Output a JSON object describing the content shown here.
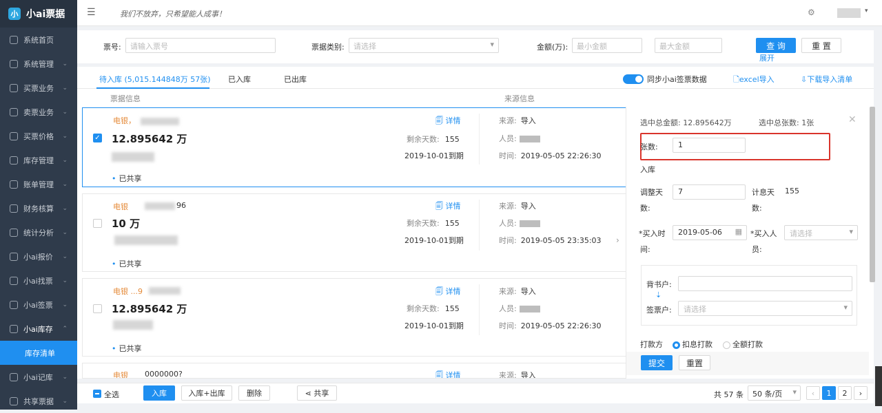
{
  "app": {
    "title": "小ai票据",
    "logo": "小",
    "slogan": "我们不放弃，只希望能人成事！"
  },
  "header": {
    "menu_icon": "☰",
    "settings_icon": "⚙",
    "caret": "▾"
  },
  "sidebar": {
    "items": [
      {
        "label": "系统首页"
      },
      {
        "label": "系统管理",
        "chevron": "⌄"
      },
      {
        "label": "买票业务",
        "chevron": "⌄"
      },
      {
        "label": "卖票业务",
        "chevron": "⌄"
      },
      {
        "label": "买票价格",
        "chevron": "⌄"
      },
      {
        "label": "库存管理",
        "chevron": "⌄"
      },
      {
        "label": "账单管理",
        "chevron": "⌄"
      },
      {
        "label": "财务核算",
        "chevron": "⌄"
      },
      {
        "label": "统计分析",
        "chevron": "⌄"
      },
      {
        "label": "小ai报价",
        "chevron": "⌄"
      },
      {
        "label": "小ai找票",
        "chevron": "⌄"
      },
      {
        "label": "小ai签票",
        "chevron": "⌄"
      },
      {
        "label": "小ai库存",
        "chevron": "⌃"
      },
      {
        "label": "小ai记库",
        "chevron": "⌄"
      },
      {
        "label": "共享票据",
        "chevron": "⌄"
      }
    ],
    "active_sub": "库存清单"
  },
  "filter": {
    "ticket_no_label": "票号:",
    "ticket_no_placeholder": "请输入票号",
    "type_label": "票据类别:",
    "type_placeholder": "请选择",
    "amount_label": "金额(万):",
    "min_placeholder": "最小金额",
    "max_placeholder": "最大金额",
    "query": "查 询",
    "reset": "重 置",
    "expand": "展开"
  },
  "tabs": {
    "pending": "待入库 (5,015.144848万 57张)",
    "in": "已入库",
    "out": "已出库",
    "sync": "同步小ai签票数据",
    "excel": "excel导入",
    "download": "下载导入清单"
  },
  "columns": {
    "ticket": "票据信息",
    "source": "来源信息"
  },
  "cards": [
    {
      "type": "电银，",
      "amount": "12.895642 万",
      "shared": "已共享",
      "detail": "详情",
      "days_label": "剩余天数:",
      "days": "155",
      "due": "2019-10-01到期",
      "src_label": "来源:",
      "src": "导入",
      "person_label": "人员:",
      "time_label": "时间:",
      "time": "2019-05-05 22:26:30",
      "checked": "✓"
    },
    {
      "type": "电银",
      "suffix": "96",
      "amount": "10 万",
      "shared": "已共享",
      "detail": "详情",
      "days_label": "剩余天数:",
      "days": "155",
      "due": "2019-10-01到期",
      "src_label": "来源:",
      "src": "导入",
      "person_label": "人员:",
      "time_label": "时间:",
      "time": "2019-05-05 23:35:03"
    },
    {
      "type": "电银 ...9",
      "amount": "12.895642 万",
      "shared": "已共享",
      "detail": "详情",
      "days_label": "剩余天数:",
      "days": "155",
      "due": "2019-10-01到期",
      "src_label": "来源:",
      "src": "导入",
      "person_label": "人员:",
      "time_label": "时间:",
      "time": "2019-05-05 22:26:30"
    },
    {
      "type": "电银",
      "suffix": "0000000?",
      "detail": "详情",
      "src_label": "来源:",
      "src": "导入"
    }
  ],
  "panel": {
    "total_amount": "选中总金额: 12.895642万",
    "total_count": "选中总张数: 1张",
    "count_label": "张数:",
    "count_value": "1",
    "in_label": "入库",
    "adjust_label_1": "调整天",
    "adjust_label_2": "数:",
    "adjust_value": "7",
    "interest_label_1": "计息天",
    "interest_label_2": "数:",
    "interest_value": "155",
    "buy_time_label_1": "*买入时",
    "buy_time_label_2": "间:",
    "buy_time_value": "2019-05-06",
    "buyer_label_1": "*买入人",
    "buyer_label_2": "员:",
    "buyer_placeholder": "请选择",
    "endorser_label": "背书户:",
    "signer_label": "签票户:",
    "signer_placeholder": "请选择",
    "pay_label": "打款方",
    "pay_opt1": "扣息打款",
    "pay_opt2": "全额打款",
    "submit": "提交",
    "reset": "重置",
    "close": "✕"
  },
  "bottom": {
    "select_all": "全选",
    "in": "入库",
    "in_out": "入库+出库",
    "delete": "删除",
    "share": "共享",
    "total": "共 57 条",
    "page_size": "50 条/页",
    "page1": "1",
    "page2": "2",
    "prev": "‹",
    "next": "›"
  }
}
